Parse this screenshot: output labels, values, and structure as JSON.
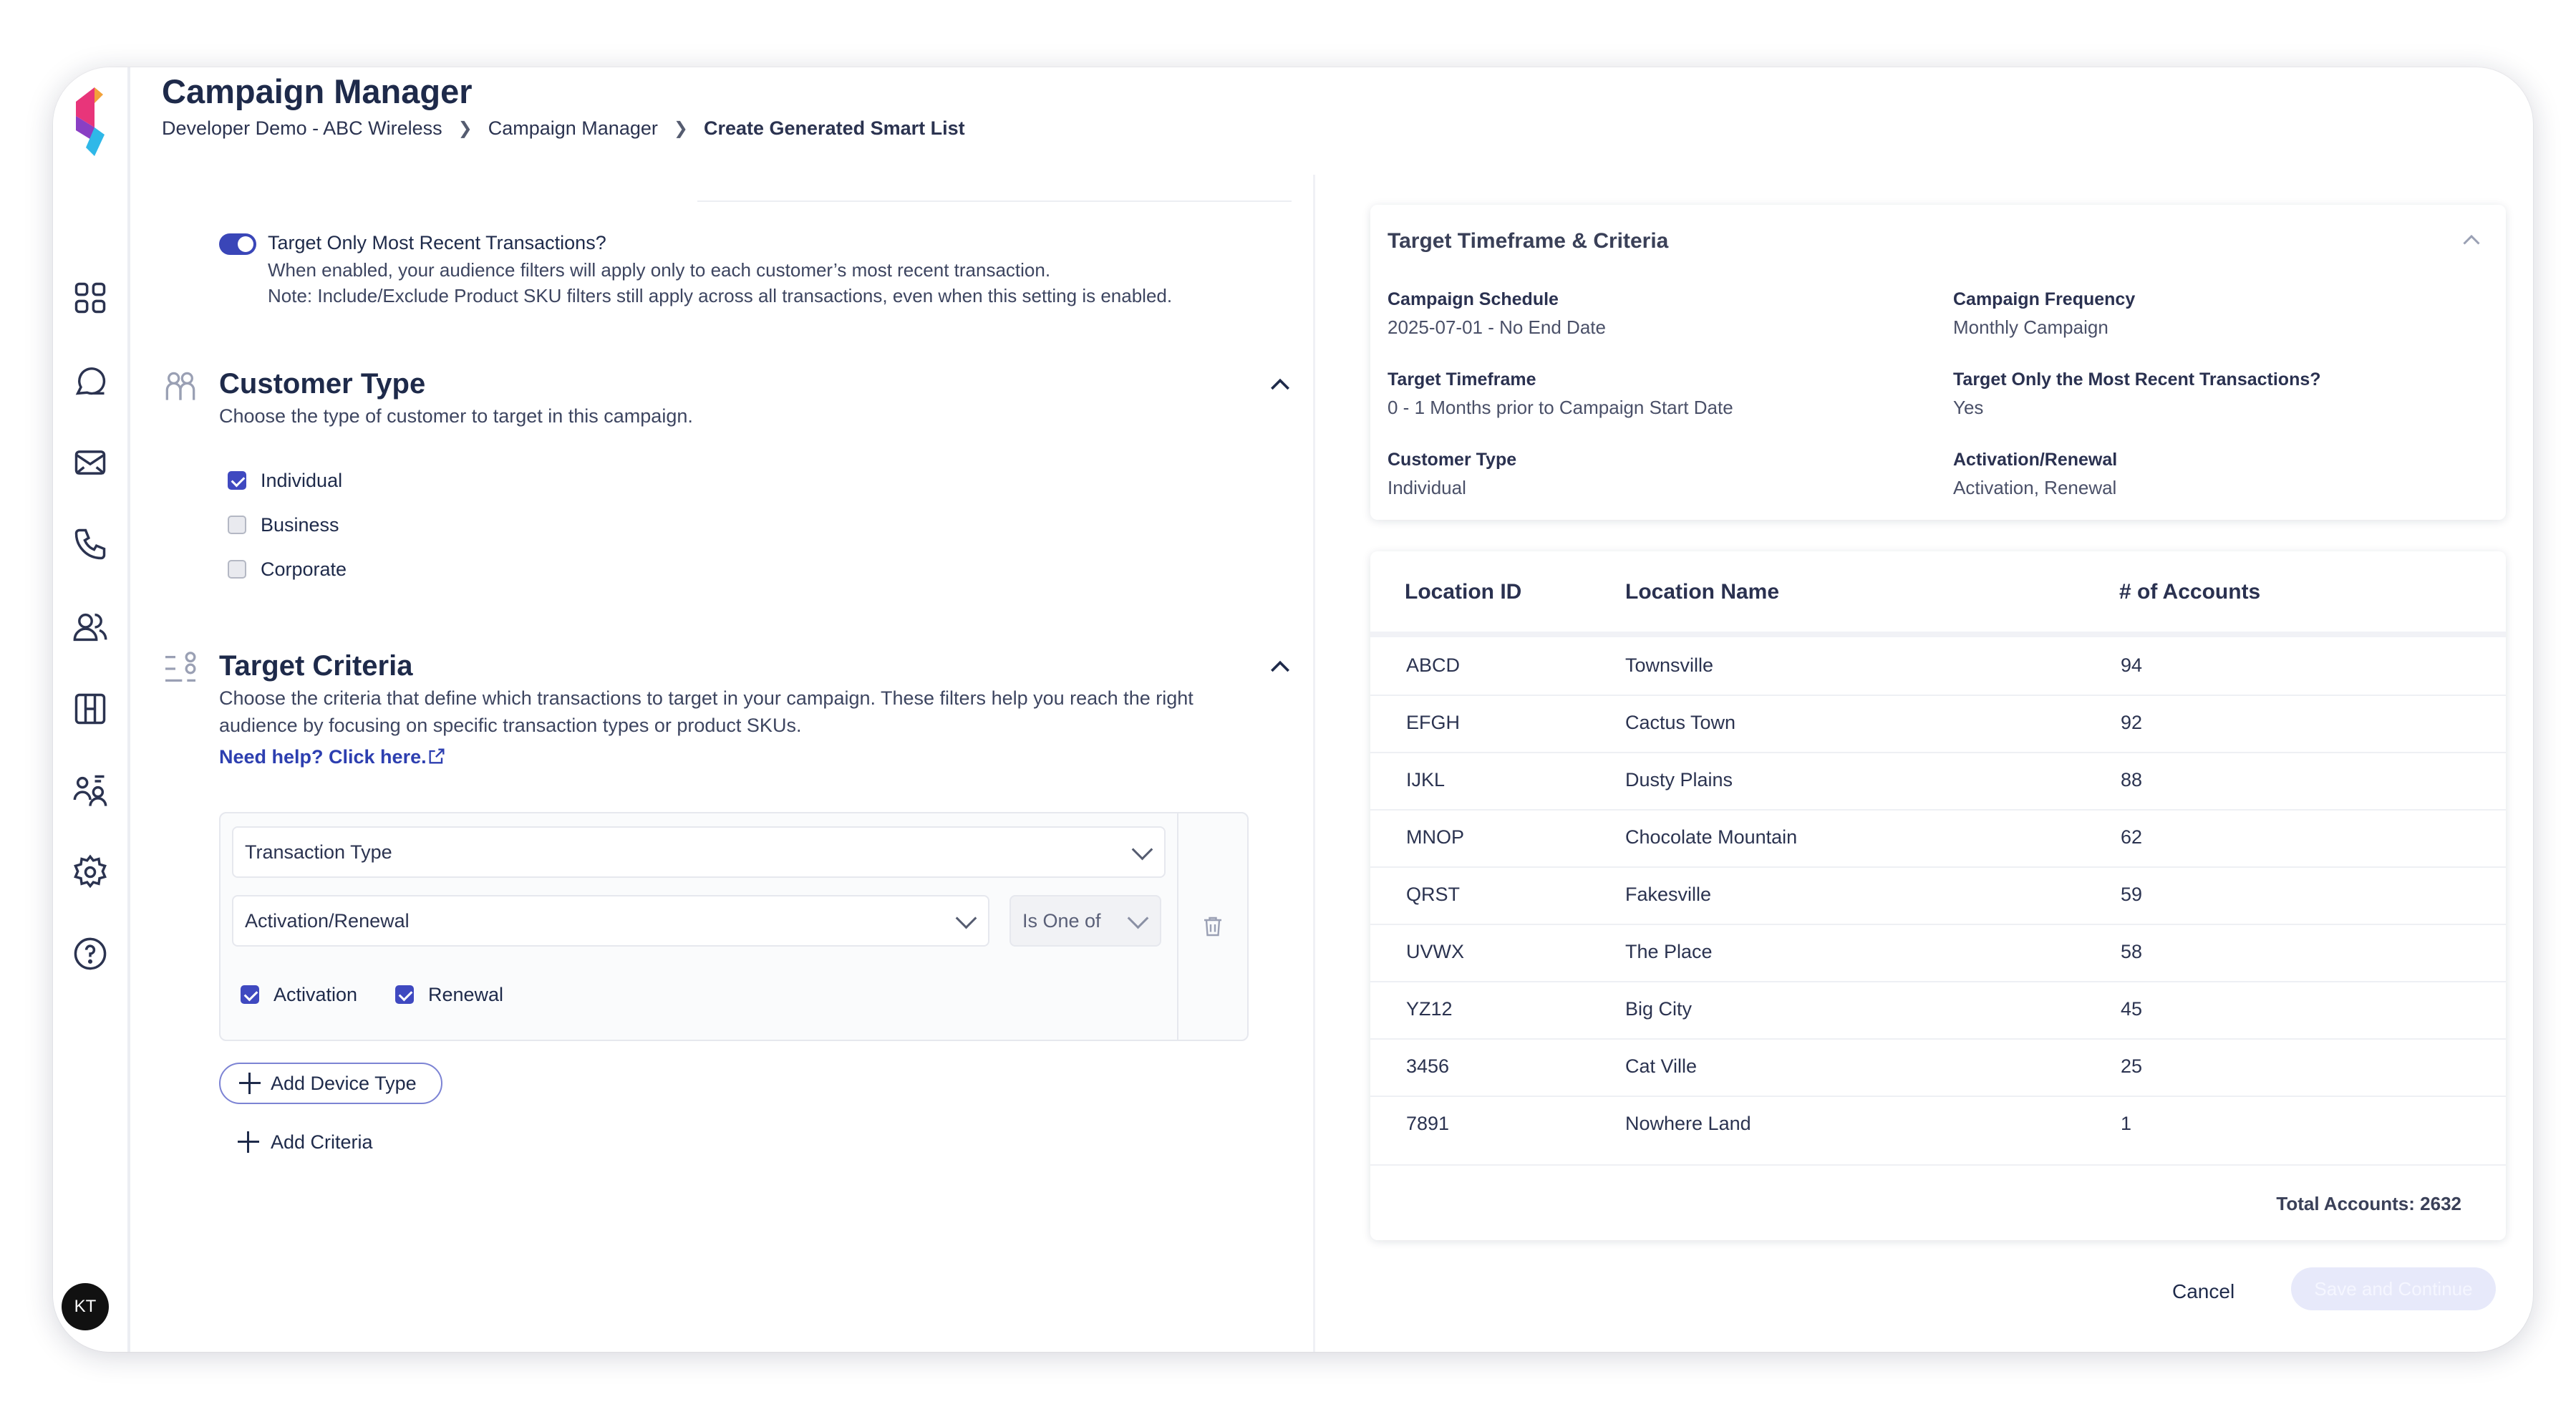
{
  "header": {
    "title": "Campaign Manager",
    "breadcrumb": [
      "Developer Demo - ABC Wireless",
      "Campaign Manager",
      "Create Generated Smart List"
    ]
  },
  "sidebar": {
    "avatar_initials": "KT",
    "icons": [
      "grid-icon",
      "chat-icon",
      "mail-icon",
      "phone-icon",
      "users-icon",
      "columns-icon",
      "user-group-icon",
      "gear-icon",
      "help-icon"
    ]
  },
  "recent_toggle": {
    "label": "Target Only Most Recent Transactions?",
    "description": "When enabled, your audience filters will apply only to each customer’s most recent transaction.",
    "note": "Note: Include/Exclude Product SKU filters still apply across all transactions, even when this setting is enabled.",
    "enabled": true
  },
  "customer_type": {
    "title": "Customer Type",
    "subtitle": "Choose the type of customer to target in this campaign.",
    "options": [
      {
        "label": "Individual",
        "checked": true
      },
      {
        "label": "Business",
        "checked": false
      },
      {
        "label": "Corporate",
        "checked": false
      }
    ]
  },
  "target_criteria": {
    "title": "Target Criteria",
    "description_line1": "Choose the criteria that define which transactions to target in your campaign. These filters help you reach the right",
    "description_line2": "audience by focusing on specific transaction types or product SKUs.",
    "help_link": "Need help? Click here.",
    "criteria_select": "Transaction Type",
    "value_select": "Activation/Renewal",
    "operator_select": "Is One of",
    "values": [
      {
        "label": "Activation",
        "checked": true
      },
      {
        "label": "Renewal",
        "checked": true
      }
    ],
    "add_device_type": "Add Device Type",
    "add_criteria": "Add Criteria"
  },
  "summary": {
    "title": "Target Timeframe & Criteria",
    "fields": [
      {
        "label": "Campaign Schedule",
        "value": "2025-07-01 - No End Date"
      },
      {
        "label": "Campaign Frequency",
        "value": "Monthly Campaign"
      },
      {
        "label": "Target Timeframe",
        "value": "0 - 1 Months prior to Campaign Start Date"
      },
      {
        "label": "Target Only the Most Recent Transactions?",
        "value": "Yes"
      },
      {
        "label": "Customer Type",
        "value": "Individual"
      },
      {
        "label": "Activation/Renewal",
        "value": "Activation, Renewal"
      }
    ]
  },
  "locations_table": {
    "headers": [
      "Location ID",
      "Location Name",
      "# of Accounts"
    ],
    "rows": [
      [
        "ABCD",
        "Townsville",
        "94"
      ],
      [
        "EFGH",
        "Cactus Town",
        "92"
      ],
      [
        "IJKL",
        "Dusty Plains",
        "88"
      ],
      [
        "MNOP",
        "Chocolate Mountain",
        "62"
      ],
      [
        "QRST",
        "Fakesville",
        "59"
      ],
      [
        "UVWX",
        "The Place",
        "58"
      ],
      [
        "YZ12",
        "Big City",
        "45"
      ],
      [
        "3456",
        "Cat Ville",
        "25"
      ],
      [
        "7891",
        "Nowhere Land",
        "1"
      ]
    ],
    "total": "Total Accounts: 2632"
  },
  "footer": {
    "cancel": "Cancel",
    "save": "Save and Continue"
  },
  "colors": {
    "accent": "#3f49c0",
    "text_dark": "#1e2a4a",
    "link": "#2d3fb0"
  }
}
